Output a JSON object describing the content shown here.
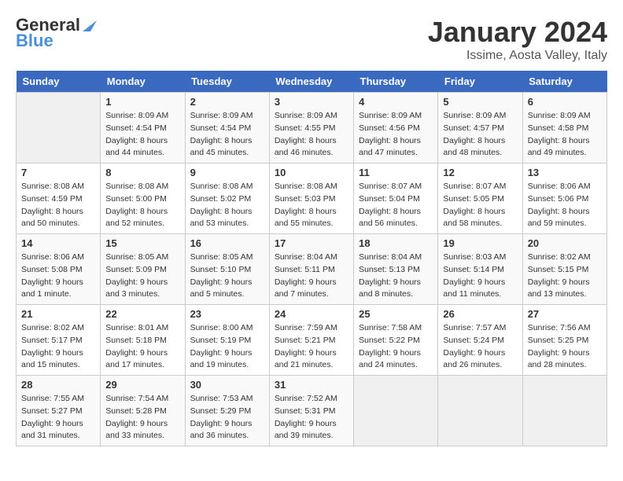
{
  "logo": {
    "line1": "General",
    "line2": "Blue"
  },
  "title": "January 2024",
  "subtitle": "Issime, Aosta Valley, Italy",
  "days_of_week": [
    "Sunday",
    "Monday",
    "Tuesday",
    "Wednesday",
    "Thursday",
    "Friday",
    "Saturday"
  ],
  "weeks": [
    [
      {
        "day": "",
        "info": ""
      },
      {
        "day": "1",
        "info": "Sunrise: 8:09 AM\nSunset: 4:54 PM\nDaylight: 8 hours\nand 44 minutes."
      },
      {
        "day": "2",
        "info": "Sunrise: 8:09 AM\nSunset: 4:54 PM\nDaylight: 8 hours\nand 45 minutes."
      },
      {
        "day": "3",
        "info": "Sunrise: 8:09 AM\nSunset: 4:55 PM\nDaylight: 8 hours\nand 46 minutes."
      },
      {
        "day": "4",
        "info": "Sunrise: 8:09 AM\nSunset: 4:56 PM\nDaylight: 8 hours\nand 47 minutes."
      },
      {
        "day": "5",
        "info": "Sunrise: 8:09 AM\nSunset: 4:57 PM\nDaylight: 8 hours\nand 48 minutes."
      },
      {
        "day": "6",
        "info": "Sunrise: 8:09 AM\nSunset: 4:58 PM\nDaylight: 8 hours\nand 49 minutes."
      }
    ],
    [
      {
        "day": "7",
        "info": "Sunrise: 8:08 AM\nSunset: 4:59 PM\nDaylight: 8 hours\nand 50 minutes."
      },
      {
        "day": "8",
        "info": "Sunrise: 8:08 AM\nSunset: 5:00 PM\nDaylight: 8 hours\nand 52 minutes."
      },
      {
        "day": "9",
        "info": "Sunrise: 8:08 AM\nSunset: 5:02 PM\nDaylight: 8 hours\nand 53 minutes."
      },
      {
        "day": "10",
        "info": "Sunrise: 8:08 AM\nSunset: 5:03 PM\nDaylight: 8 hours\nand 55 minutes."
      },
      {
        "day": "11",
        "info": "Sunrise: 8:07 AM\nSunset: 5:04 PM\nDaylight: 8 hours\nand 56 minutes."
      },
      {
        "day": "12",
        "info": "Sunrise: 8:07 AM\nSunset: 5:05 PM\nDaylight: 8 hours\nand 58 minutes."
      },
      {
        "day": "13",
        "info": "Sunrise: 8:06 AM\nSunset: 5:06 PM\nDaylight: 8 hours\nand 59 minutes."
      }
    ],
    [
      {
        "day": "14",
        "info": "Sunrise: 8:06 AM\nSunset: 5:08 PM\nDaylight: 9 hours\nand 1 minute."
      },
      {
        "day": "15",
        "info": "Sunrise: 8:05 AM\nSunset: 5:09 PM\nDaylight: 9 hours\nand 3 minutes."
      },
      {
        "day": "16",
        "info": "Sunrise: 8:05 AM\nSunset: 5:10 PM\nDaylight: 9 hours\nand 5 minutes."
      },
      {
        "day": "17",
        "info": "Sunrise: 8:04 AM\nSunset: 5:11 PM\nDaylight: 9 hours\nand 7 minutes."
      },
      {
        "day": "18",
        "info": "Sunrise: 8:04 AM\nSunset: 5:13 PM\nDaylight: 9 hours\nand 8 minutes."
      },
      {
        "day": "19",
        "info": "Sunrise: 8:03 AM\nSunset: 5:14 PM\nDaylight: 9 hours\nand 11 minutes."
      },
      {
        "day": "20",
        "info": "Sunrise: 8:02 AM\nSunset: 5:15 PM\nDaylight: 9 hours\nand 13 minutes."
      }
    ],
    [
      {
        "day": "21",
        "info": "Sunrise: 8:02 AM\nSunset: 5:17 PM\nDaylight: 9 hours\nand 15 minutes."
      },
      {
        "day": "22",
        "info": "Sunrise: 8:01 AM\nSunset: 5:18 PM\nDaylight: 9 hours\nand 17 minutes."
      },
      {
        "day": "23",
        "info": "Sunrise: 8:00 AM\nSunset: 5:19 PM\nDaylight: 9 hours\nand 19 minutes."
      },
      {
        "day": "24",
        "info": "Sunrise: 7:59 AM\nSunset: 5:21 PM\nDaylight: 9 hours\nand 21 minutes."
      },
      {
        "day": "25",
        "info": "Sunrise: 7:58 AM\nSunset: 5:22 PM\nDaylight: 9 hours\nand 24 minutes."
      },
      {
        "day": "26",
        "info": "Sunrise: 7:57 AM\nSunset: 5:24 PM\nDaylight: 9 hours\nand 26 minutes."
      },
      {
        "day": "27",
        "info": "Sunrise: 7:56 AM\nSunset: 5:25 PM\nDaylight: 9 hours\nand 28 minutes."
      }
    ],
    [
      {
        "day": "28",
        "info": "Sunrise: 7:55 AM\nSunset: 5:27 PM\nDaylight: 9 hours\nand 31 minutes."
      },
      {
        "day": "29",
        "info": "Sunrise: 7:54 AM\nSunset: 5:28 PM\nDaylight: 9 hours\nand 33 minutes."
      },
      {
        "day": "30",
        "info": "Sunrise: 7:53 AM\nSunset: 5:29 PM\nDaylight: 9 hours\nand 36 minutes."
      },
      {
        "day": "31",
        "info": "Sunrise: 7:52 AM\nSunset: 5:31 PM\nDaylight: 9 hours\nand 39 minutes."
      },
      {
        "day": "",
        "info": ""
      },
      {
        "day": "",
        "info": ""
      },
      {
        "day": "",
        "info": ""
      }
    ]
  ]
}
